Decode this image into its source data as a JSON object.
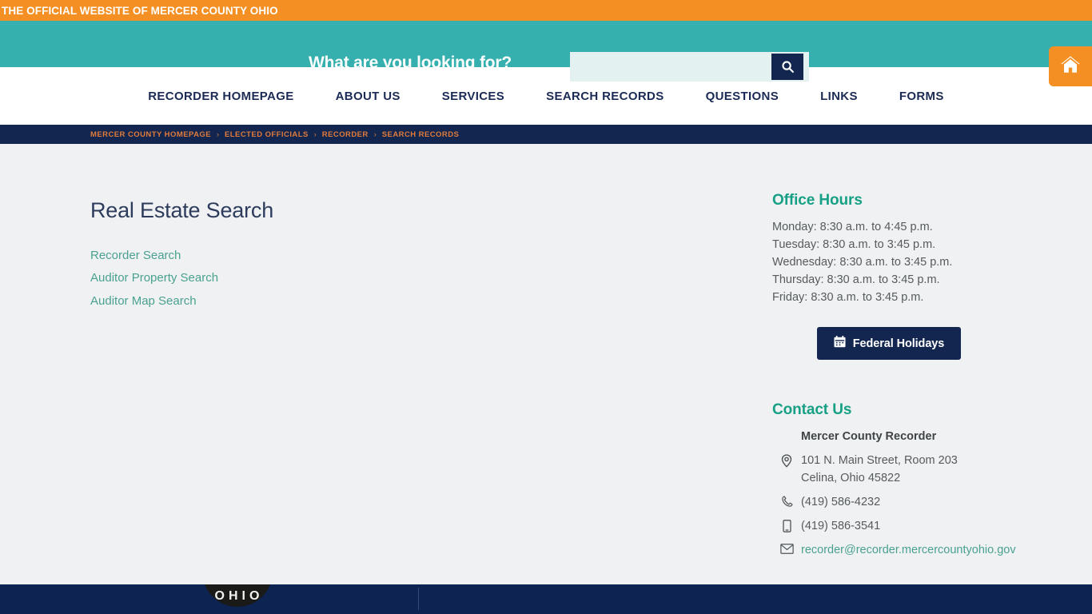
{
  "topbar": {
    "text": "THE OFFICIAL WEBSITE OF MERCER COUNTY OHIO",
    "background_color": "#f49023",
    "text_color": "#ffffff"
  },
  "search_header": {
    "prompt": "What are you looking for?",
    "input_value": "",
    "input_placeholder": "",
    "search_icon": "search-icon",
    "home_icon": "home-icon",
    "background_color": "#36b0ae",
    "button_color": "#12264f"
  },
  "nav": {
    "items": [
      {
        "label": "RECORDER HOMEPAGE"
      },
      {
        "label": "ABOUT US"
      },
      {
        "label": "SERVICES"
      },
      {
        "label": "SEARCH RECORDS"
      },
      {
        "label": "QUESTIONS"
      },
      {
        "label": "LINKS"
      },
      {
        "label": "FORMS"
      }
    ],
    "text_color": "#1b2b55"
  },
  "breadcrumb": {
    "separator": "›",
    "items": [
      {
        "label": "MERCER COUNTY HOMEPAGE"
      },
      {
        "label": "ELECTED OFFICIALS"
      },
      {
        "label": "RECORDER"
      },
      {
        "label": "SEARCH RECORDS"
      }
    ],
    "background_color": "#12264f",
    "text_color": "#e07b3c"
  },
  "main": {
    "title": "Real Estate Search",
    "links": [
      {
        "label": "Recorder Search"
      },
      {
        "label": "Auditor Property Search"
      },
      {
        "label": "Auditor Map Search"
      }
    ],
    "link_color": "#4aa190"
  },
  "sidebar": {
    "office_hours": {
      "heading": "Office Hours",
      "rows": [
        "Monday: 8:30 a.m. to 4:45 p.m.",
        "Tuesday: 8:30 a.m. to 3:45 p.m.",
        "Wednesday: 8:30 a.m. to 3:45 p.m.",
        "Thursday: 8:30 a.m. to 3:45 p.m.",
        "Friday: 8:30 a.m. to 3:45 p.m."
      ]
    },
    "holidays_button": {
      "label": "Federal Holidays",
      "icon": "calendar-icon",
      "background_color": "#12264f"
    },
    "contact": {
      "heading": "Contact Us",
      "organization": "Mercer County Recorder",
      "address_line1": "101 N. Main Street, Room 203",
      "address_line2": "Celina, Ohio 45822",
      "phone": "(419) 586-4232",
      "mobile": "(419) 586-3541",
      "email": "recorder@recorder.mercercountyohio.gov",
      "address_icon": "map-pin-icon",
      "phone_icon": "phone-icon",
      "mobile_icon": "mobile-icon",
      "email_icon": "envelope-icon"
    },
    "heading_color": "#17a085"
  },
  "footer": {
    "seal_text": "OHIO",
    "background_color": "#0d2352"
  }
}
